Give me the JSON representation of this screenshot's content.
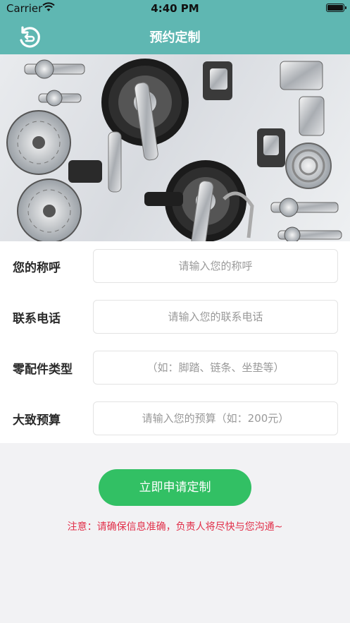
{
  "status_bar": {
    "carrier": "Carrier",
    "time": "4:40 PM"
  },
  "header": {
    "title": "预约定制",
    "back_icon": "back-icon"
  },
  "banner": {
    "image": "bicycle-components-photo"
  },
  "form": {
    "fields": [
      {
        "label": "您的称呼",
        "placeholder": "请输入您的称呼"
      },
      {
        "label": "联系电话",
        "placeholder": "请输入您的联系电话"
      },
      {
        "label": "零配件类型",
        "placeholder": "（如：脚踏、链条、坐垫等）"
      },
      {
        "label": "大致预算",
        "placeholder": "请输入您的预算（如：200元）"
      }
    ]
  },
  "actions": {
    "submit_label": "立即申请定制"
  },
  "notice": "注意：请确保信息准确，负责人将尽快与您沟通~",
  "colors": {
    "header": "#5fb7b2",
    "button": "#32c064",
    "notice": "#e1304a"
  }
}
